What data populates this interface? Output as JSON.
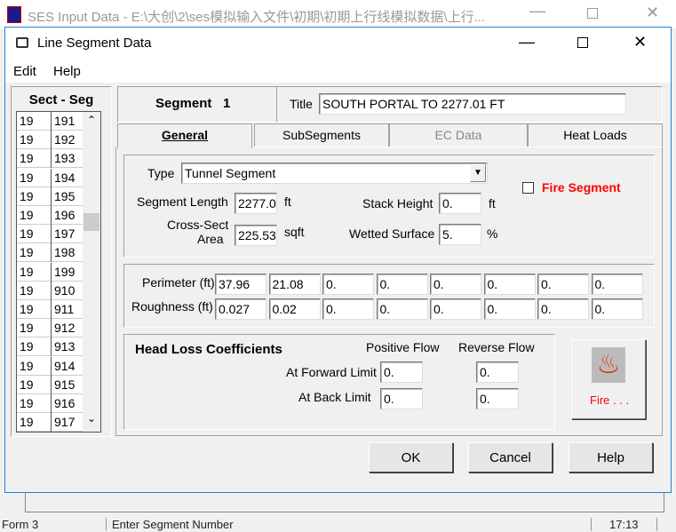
{
  "outer_window": {
    "title": "SES Input Data - E:\\大创\\2\\ses模拟输入文件\\初期\\初期上行线模拟数据\\上行..."
  },
  "dialog": {
    "title": "Line Segment Data"
  },
  "menu": [
    "Edit",
    "Help"
  ],
  "list": {
    "header": "Sect  -  Seg",
    "rows": [
      [
        "19",
        "191"
      ],
      [
        "19",
        "192"
      ],
      [
        "19",
        "193"
      ],
      [
        "19",
        "194"
      ],
      [
        "19",
        "195"
      ],
      [
        "19",
        "196"
      ],
      [
        "19",
        "197"
      ],
      [
        "19",
        "198"
      ],
      [
        "19",
        "199"
      ],
      [
        "19",
        "910"
      ],
      [
        "19",
        "911"
      ],
      [
        "19",
        "912"
      ],
      [
        "19",
        "913"
      ],
      [
        "19",
        "914"
      ],
      [
        "19",
        "915"
      ],
      [
        "19",
        "916"
      ],
      [
        "19",
        "917"
      ]
    ]
  },
  "segment": {
    "label": "Segment",
    "number": "1",
    "title_label": "Title",
    "title_value": "SOUTH PORTAL TO 2277.01 FT"
  },
  "tabs": [
    {
      "label": "General",
      "active": true
    },
    {
      "label": "SubSegments"
    },
    {
      "label": "EC Data",
      "disabled": true
    },
    {
      "label": "Heat Loads"
    }
  ],
  "general": {
    "type_label": "Type",
    "type_value": "Tunnel Segment",
    "fire_segment_label": "Fire Segment",
    "fire_segment_checked": false,
    "segment_length_label": "Segment Length",
    "segment_length": "2277.0",
    "segment_length_unit": "ft",
    "stack_height_label": "Stack Height",
    "stack_height": "0.",
    "stack_height_unit": "ft",
    "cross_sect_label1": "Cross-Sect",
    "cross_sect_label2": "Area",
    "cross_sect": "225.53",
    "cross_sect_unit": "sqft",
    "wetted_label": "Wetted Surface",
    "wetted": "5.",
    "wetted_unit": "%",
    "perimeter_label": "Perimeter (ft)",
    "perimeter": [
      "37.96",
      "21.08",
      "0.",
      "0.",
      "0.",
      "0.",
      "0.",
      "0."
    ],
    "roughness_label": "Roughness (ft)",
    "roughness": [
      "0.027",
      "0.02",
      "0.",
      "0.",
      "0.",
      "0.",
      "0.",
      "0."
    ],
    "head_loss_title": "Head Loss Coefficients",
    "positive_flow": "Positive Flow",
    "reverse_flow": "Reverse Flow",
    "forward_label": "At Forward Limit",
    "forward_pos": "0.",
    "forward_rev": "0.",
    "back_label": "At Back Limit",
    "back_pos": "0.",
    "back_rev": "0.",
    "fire_button": "Fire . . ."
  },
  "buttons": {
    "ok": "OK",
    "cancel": "Cancel",
    "help": "Help"
  },
  "status": {
    "form": "Form 3",
    "message": "Enter Segment Number",
    "time": "17:13"
  },
  "colors": {
    "accent": "#0078d7",
    "fire": "#ff0000"
  }
}
